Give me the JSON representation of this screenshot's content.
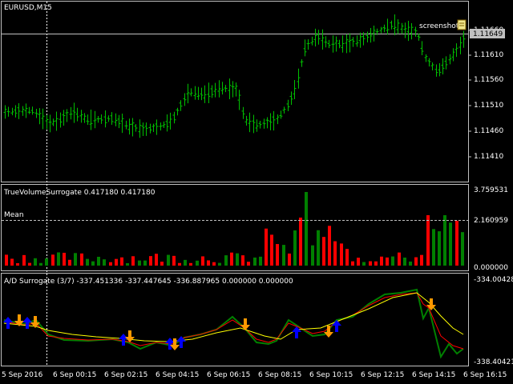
{
  "colors": {
    "background": "#000000",
    "border": "#c0c0c0",
    "candles": "#00c000",
    "crosshair": "#ffffff",
    "volume_green": "#008000",
    "volume_red": "#ff0000",
    "ad_green": "#008000",
    "ad_red": "#ff0000",
    "ad_yellow": "#ffff00",
    "arrow_up": "#0000ff",
    "arrow_down": "#ff9900"
  },
  "main_chart": {
    "symbol_label": "EURUSD,M15",
    "price_labels": [
      "1.11660",
      "1.11610",
      "1.11560",
      "1.11510",
      "1.11460",
      "1.11410"
    ],
    "current_price": "1.11649",
    "screenshot_label": "screenshot",
    "screenshot_icon": "document-icon"
  },
  "volume_indicator": {
    "title": "TrueVolumeSurrogate 0.417180 0.417180",
    "mean_label": "Mean",
    "labels": [
      "3.759531",
      "2.160959",
      "0.000000"
    ]
  },
  "ad_indicator": {
    "title": "A/D Surrogate (3/7) -337.451336 -337.447645 -336.887965 0.000000 0.000000",
    "labels": [
      "-334.00428",
      "-338.40421"
    ]
  },
  "time_axis": [
    "5 Sep 2016",
    "6 Sep 00:15",
    "6 Sep 02:15",
    "6 Sep 04:15",
    "6 Sep 06:15",
    "6 Sep 08:15",
    "6 Sep 10:15",
    "6 Sep 12:15",
    "6 Sep 14:15",
    "6 Sep 16:15"
  ]
}
